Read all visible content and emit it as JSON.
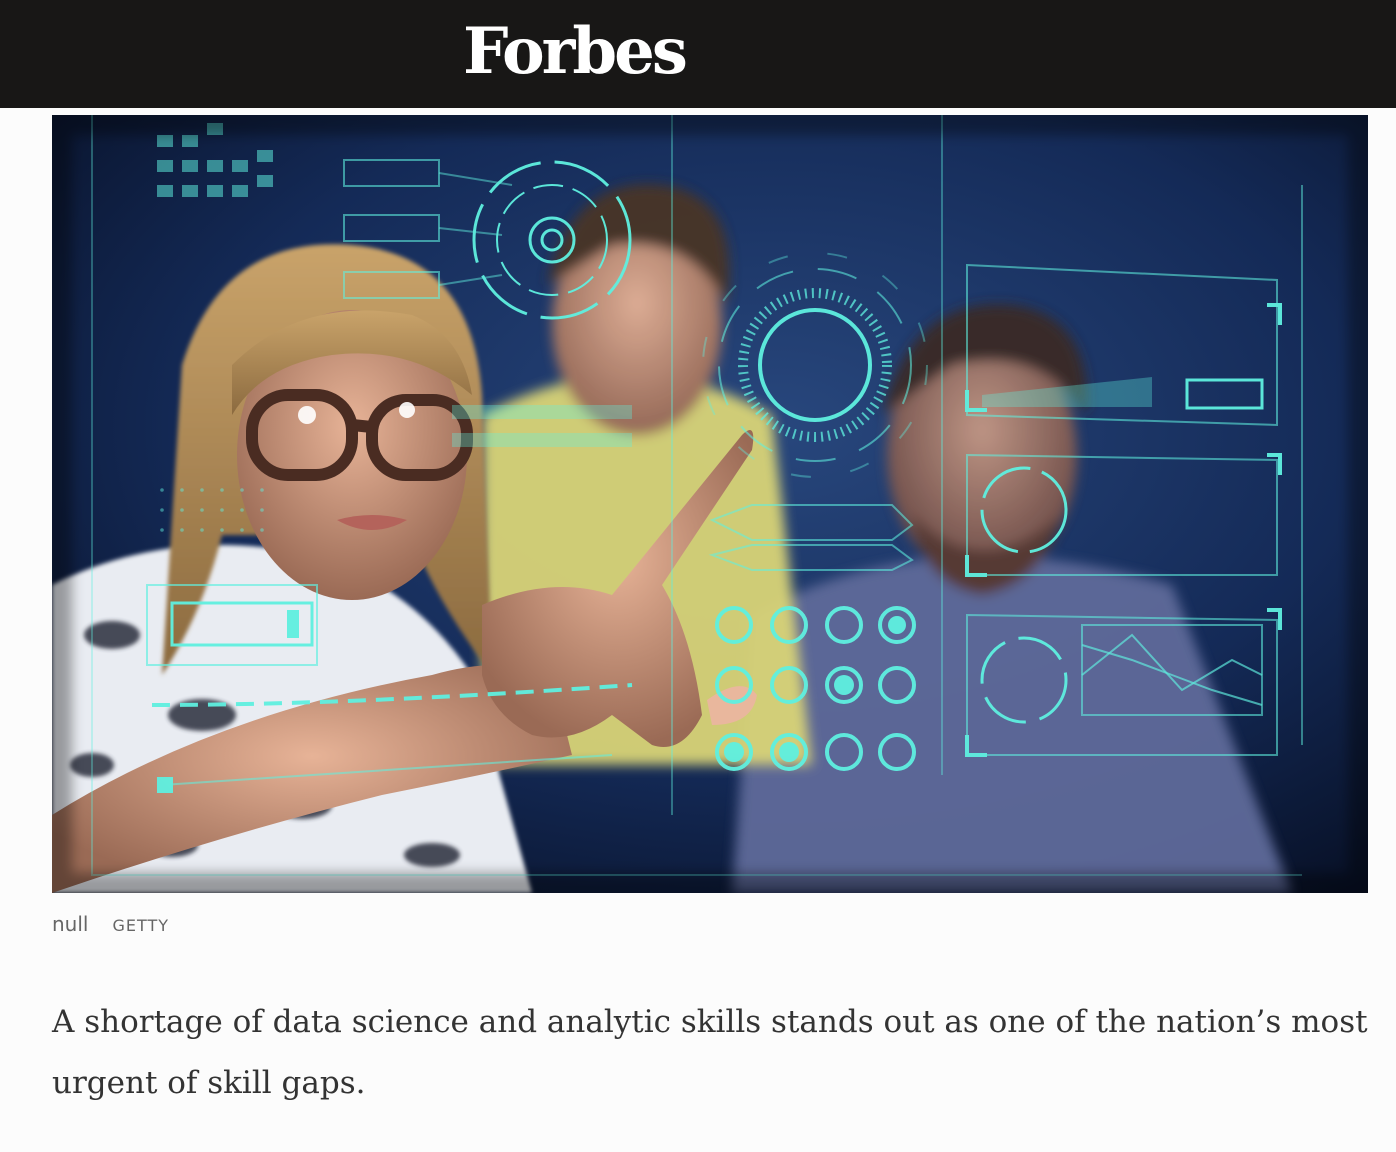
{
  "header": {
    "logo": "Forbes"
  },
  "hero": {
    "image_description": "three-people-touching-holographic-interface-icon",
    "caption": "null",
    "credit": "GETTY"
  },
  "article": {
    "lede": "A shortage of data science and analytic skills stands out as one of the nation’s most urgent of skill gaps."
  },
  "colors": {
    "header_bg": "#181716",
    "hologram": "#5ff0e0",
    "caption_text": "#666666",
    "body_text": "#333333"
  }
}
